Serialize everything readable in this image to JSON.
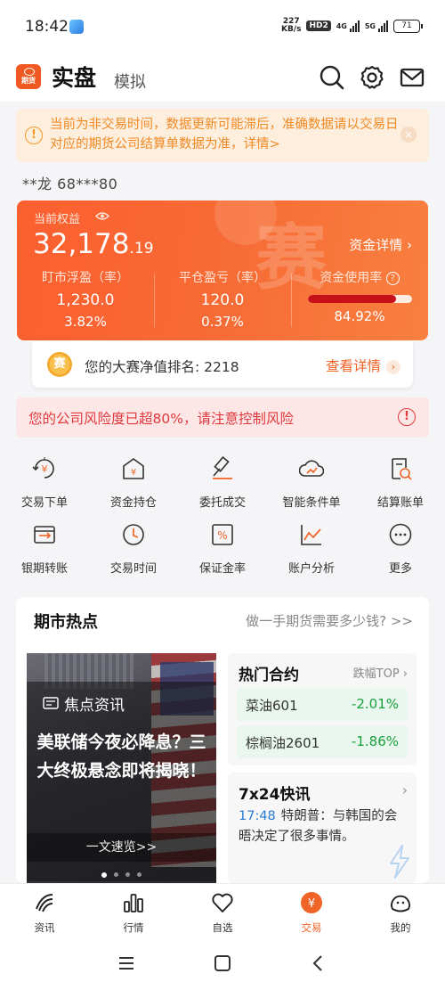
{
  "status": {
    "time": "18:42",
    "netspeed_value": "227",
    "netspeed_unit": "KB/s",
    "hd": "HD2",
    "sig1_label": "4G",
    "sig2_label": "5G",
    "battery": "71"
  },
  "header": {
    "logo_text": "期货",
    "tab_real": "实盘",
    "tab_sim": "模拟"
  },
  "notice": {
    "text": "当前为非交易时间，数据更新可能滞后，准确数据请以交易日对应的期货公司结算单数据为准，详情>",
    "close": "×",
    "icon": "!"
  },
  "account": "**龙  68***80",
  "equity": {
    "label": "当前权益",
    "value_int": "32,178",
    "value_dec": ".19",
    "detail_link": "资金详情 ›",
    "watermark": "赛",
    "float_label": "盯市浮盈（率）",
    "float_value": "1,230.0",
    "float_pct": "3.82%",
    "close_label": "平仓盈亏（率）",
    "close_value": "120.0",
    "close_pct": "0.37%",
    "usage_label": "资金使用率",
    "usage_pct": "84.92%",
    "usage_fraction": 0.8492
  },
  "rank": {
    "badge": "赛",
    "text": "您的大赛净值排名: 2218",
    "link": "查看详情"
  },
  "risk": {
    "text": "您的公司风险度已超80%，请注意控制风险",
    "icon": "!"
  },
  "grid": [
    {
      "label": "交易下单",
      "icon": "trade-order-icon"
    },
    {
      "label": "资金持仓",
      "icon": "fund-position-icon"
    },
    {
      "label": "委托成交",
      "icon": "entrust-deal-icon"
    },
    {
      "label": "智能条件单",
      "icon": "smart-condition-icon"
    },
    {
      "label": "结算账单",
      "icon": "settlement-bill-icon"
    },
    {
      "label": "银期转账",
      "icon": "bank-transfer-icon"
    },
    {
      "label": "交易时间",
      "icon": "clock-icon"
    },
    {
      "label": "保证金率",
      "icon": "margin-rate-icon"
    },
    {
      "label": "账户分析",
      "icon": "analysis-chart-icon"
    },
    {
      "label": "更多",
      "icon": "more-icon"
    }
  ],
  "hot": {
    "title": "期市热点",
    "link": "做一手期货需要多少钱? >>",
    "banner": {
      "tag": "焦点资讯",
      "headline": "美联储今夜必降息？三大终极悬念即将揭晓！",
      "button": "一文速览>>"
    },
    "contracts_title": "热门合约",
    "contracts_top": "跌幅TOP ›",
    "contracts": [
      {
        "name": "菜油601",
        "change": "-2.01%"
      },
      {
        "name": "棕榈油2601",
        "change": "-1.86%"
      }
    ],
    "news_title": "7x24快讯",
    "news_time": "17:48",
    "news_text": "特朗普：与韩国的会晤决定了很多事情。"
  },
  "tabs": [
    {
      "label": "资讯",
      "icon": "news-icon"
    },
    {
      "label": "行情",
      "icon": "market-icon"
    },
    {
      "label": "自选",
      "icon": "favorite-icon"
    },
    {
      "label": "交易",
      "icon": "trade-icon"
    },
    {
      "label": "我的",
      "icon": "profile-icon"
    }
  ],
  "colors": {
    "accent": "#f06427",
    "card_orange": "#fb5f2f",
    "risk_red": "#e0393e",
    "down_green": "#1a9f3f"
  }
}
